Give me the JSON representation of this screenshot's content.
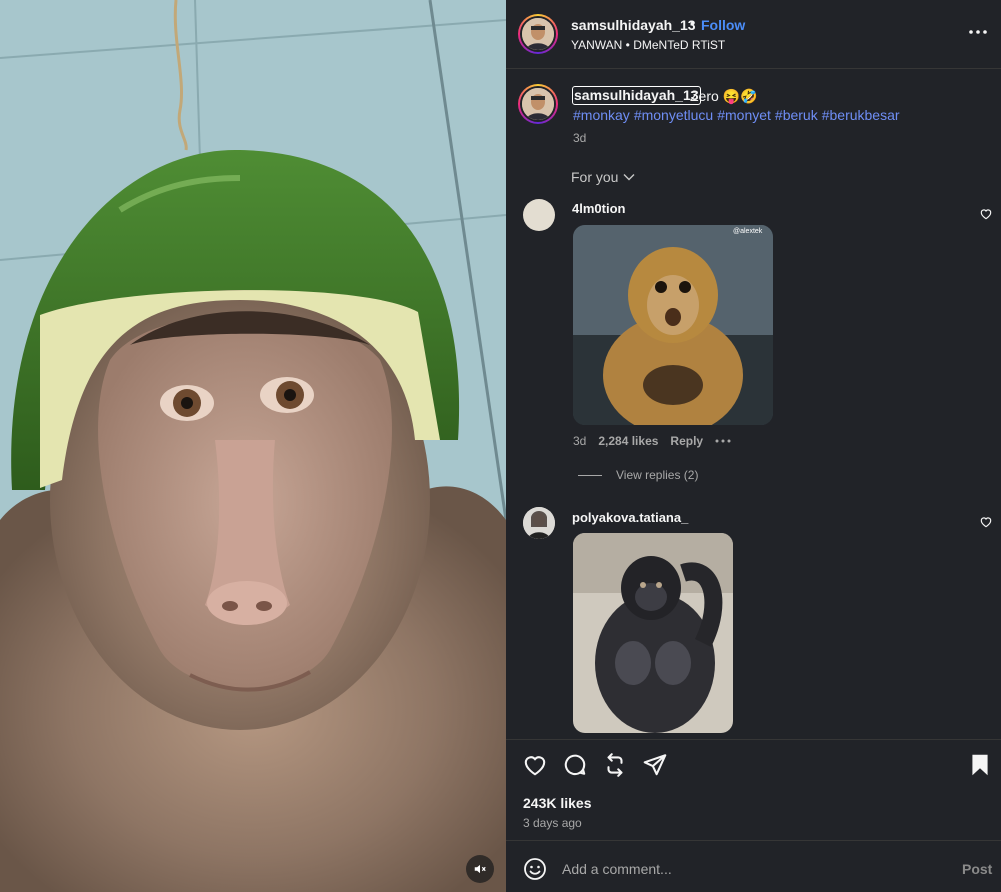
{
  "post": {
    "author": "samsulhidayah_13",
    "follow_label": "Follow",
    "dot": "•",
    "audio": "YANWAN • DMeNTeD RTiST",
    "more_icon": "more-horizontal-icon"
  },
  "caption": {
    "username": "samsulhidayah_13",
    "text": "Zero 😝🤣",
    "hashtags": [
      "#monkay",
      "#monyetlucu",
      "#monyet",
      "#beruk",
      "#berukbesar"
    ],
    "time": "3d"
  },
  "comments_filter": {
    "label": "For you"
  },
  "comments": [
    {
      "username": "4lm0tion",
      "gif_watermark": "@alextek",
      "time": "3d",
      "likes": "2,284 likes",
      "reply_label": "Reply",
      "view_replies": "View replies (2)"
    },
    {
      "username": "polyakova.tatiana_"
    }
  ],
  "actions": {
    "icons": [
      "heart-icon",
      "comment-icon",
      "repost-icon",
      "share-icon",
      "bookmark-icon"
    ],
    "likes": "243K likes",
    "posted": "3 days ago"
  },
  "composer": {
    "placeholder": "Add a comment...",
    "post_label": "Post"
  },
  "colors": {
    "panel_bg": "#212328",
    "follow_blue": "#4b8df8",
    "hashtag_blue": "#6f8ef5",
    "muted_text": "#a8a8a8"
  }
}
